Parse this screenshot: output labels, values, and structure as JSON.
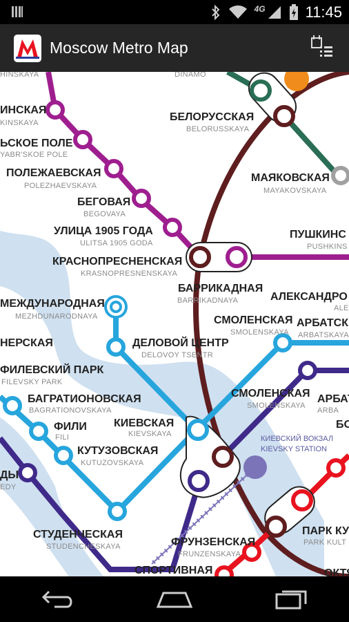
{
  "status_bar": {
    "time": "11:45",
    "network": "4G"
  },
  "app": {
    "title": "Moscow Metro Map",
    "logo_letter": "M"
  },
  "colors": {
    "line_purple": "#9e1e8f",
    "line_brown": "#5e1d1e",
    "line_lightblue": "#27a5dd",
    "line_darkblue": "#3f2a8a",
    "line_green": "#2a6e55",
    "line_red": "#e8131f",
    "line_orange": "#f08c1c",
    "line_grey": "#a0a0a0",
    "water": "#cfe0f0"
  },
  "stations": {
    "top_partial_1": {
      "en": "HINSKAYA"
    },
    "dinamo": {
      "en": "DINAMO"
    },
    "ninskaya": {
      "ru": "ИНСКАЯ",
      "en": "KINSKAYA"
    },
    "polye": {
      "ru": "ЬСКОЕ ПОЛЕ",
      "en": "YABR'SKOE POLE"
    },
    "polezhaevskaya": {
      "ru": "ПОЛЕЖАЕВСКАЯ",
      "en": "POLEZHAEVSKAYA"
    },
    "begovaya": {
      "ru": "БЕГОВАЯ",
      "en": "BEGOVAYA"
    },
    "ulitsa1905": {
      "ru": "УЛИЦА 1905 ГОДА",
      "en": "ULITSA 1905 GODA"
    },
    "krasnopresnenskaya": {
      "ru": "КРАСНОПРЕСНЕНСКАЯ",
      "en": "KRASNOPRESNENSKAYA"
    },
    "barrikadnaya": {
      "ru": "БАРРИКАДНАЯ",
      "en": "BARRIKADNAYA"
    },
    "belorusskaya": {
      "ru": "БЕЛОРУССКАЯ",
      "en": "BELORUSSKAYA"
    },
    "mayakovskaya": {
      "ru": "МАЯКОВСКАЯ",
      "en": "MAYAKOVSKAYA"
    },
    "pushkinskaya": {
      "ru": "ПУШКИНС",
      "en": "PUSHKINS"
    },
    "aleksandrovsky": {
      "ru": "АЛЕКСАНДРО",
      "en": "ALE"
    },
    "mezhdunarodnaya": {
      "ru": "МЕЖДУНАРОДНАЯ",
      "en": "MEZHDUNARODNAYA"
    },
    "smolenskaya_top": {
      "ru": "СМОЛЕНСКАЯ",
      "en": "SMOLENSKAYA"
    },
    "arbatskaya_top": {
      "ru": "АРБАТСК",
      "en": "ARBATSKAYA"
    },
    "vystavochnaya": {
      "ru": "НЕРСКАЯ",
      "en": ""
    },
    "delovoy_tsentr": {
      "ru": "ДЕЛОВОЙ ЦЕНТР",
      "en": "DELOVOY TSENTR"
    },
    "filevsky_park": {
      "ru": "ФИЛЕВСКИЙ ПАРК",
      "en": "FILEVSKY PARK"
    },
    "bagrationovskaya": {
      "ru": "БАГРАТИОНОВСКАЯ",
      "en": "BAGRATIONOVSKAYA"
    },
    "fili": {
      "ru": "ФИЛИ",
      "en": "FILI"
    },
    "kievskaya": {
      "ru": "КИЕВСКАЯ",
      "en": "KIEVSKAYA"
    },
    "kutuzovskaya": {
      "ru": "КУТУЗОВСКАЯ",
      "en": "KUTUZOVSKAYA"
    },
    "smolenskaya_mid": {
      "ru": "СМОЛЕНСКАЯ",
      "en": "SMOLENSKAYA"
    },
    "arbat_mid": {
      "ru": "АРБАТ",
      "en": "ARBA"
    },
    "bo_partial": {
      "ru": "БО"
    },
    "kievsky_vokzal": {
      "ru": "КИЕВСКИЙ ВОКЗАЛ",
      "en": "KIEVSKY STATION"
    },
    "edy_partial": {
      "ru": "ДЫ",
      "en": "EDY"
    },
    "studencheskaya": {
      "ru": "СТУДЕНЧЕСКАЯ",
      "en": "STUDENCHESKAYA"
    },
    "frunzenskaya": {
      "ru": "ФРУНЗЕНСКАЯ",
      "en": "FRUNZENSKAYA"
    },
    "sportivnaya": {
      "ru": "СПОРТИВНАЯ",
      "en": ""
    },
    "park_kultury": {
      "ru": "ПАРК КУ",
      "en": "PARK KULT"
    },
    "oktya_partial": {
      "ru": "ОКТЯ"
    }
  }
}
